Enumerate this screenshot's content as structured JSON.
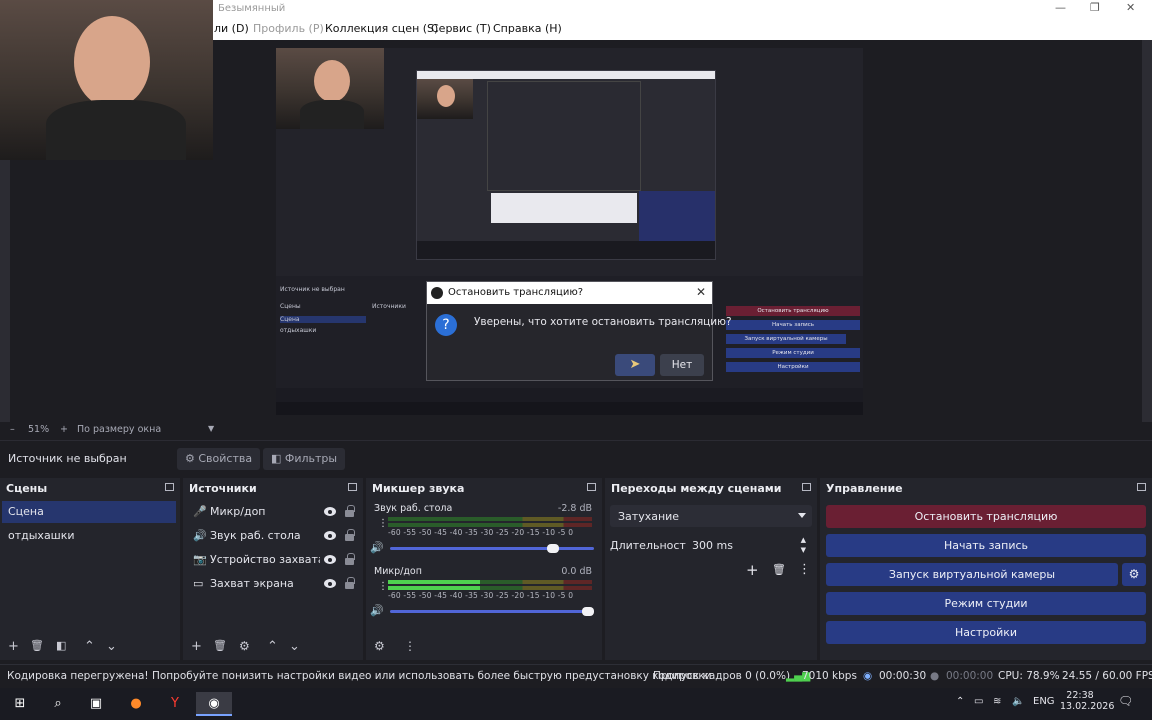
{
  "window": {
    "title": "Безымянный",
    "controls": [
      "—",
      "❐",
      "✕"
    ]
  },
  "menu": {
    "items": [
      "ли (D)",
      "Профиль (P)",
      "Коллекция сцен (S)",
      "Сервис (T)",
      "Справка (H)"
    ]
  },
  "stop_dialog": {
    "title": "Остановить трансляцию?",
    "message": "Уверены, что хотите остановить трансляцию?",
    "yes_label": "Да",
    "no_label": "Нет"
  },
  "zoom": {
    "value": "51%",
    "mode": "По размеру окна"
  },
  "context": {
    "no_source": "Источник не выбран",
    "properties": "Свойства",
    "filters": "Фильтры"
  },
  "scenes": {
    "title": "Сцены",
    "items": [
      "Сцена",
      "отдыхашки"
    ],
    "active_index": 0
  },
  "sources": {
    "title": "Источники",
    "items": [
      {
        "name": "Микр/доп",
        "icon": "microphone-icon"
      },
      {
        "name": "Звук раб. стола",
        "icon": "speaker-icon"
      },
      {
        "name": "Устройство захвата в",
        "icon": "camera-icon"
      },
      {
        "name": "Захват экрана",
        "icon": "monitor-icon"
      }
    ]
  },
  "mixer": {
    "title": "Микшер звука",
    "scale": "-60 -55 -50 -45 -40 -35 -30 -25 -20 -15 -10 -5 0",
    "channels": [
      {
        "name": "Звук раб. стола",
        "db": "-2.8 dB",
        "level": 0.0,
        "volume": 0.83
      },
      {
        "name": "Микр/доп",
        "db": "0.0 dB",
        "level": 0.45,
        "volume": 1.0
      }
    ]
  },
  "transitions": {
    "title": "Переходы между сценами",
    "selected": "Затухание",
    "duration_label": "Длительность",
    "duration_value": "300 ms"
  },
  "controls": {
    "title": "Управление",
    "stop_stream": "Остановить трансляцию",
    "start_recording": "Начать запись",
    "virtual_camera": "Запуск виртуальной камеры",
    "studio_mode": "Режим студии",
    "settings": "Настройки"
  },
  "status": {
    "warning": "Кодировка перегружена! Попробуйте понизить настройки видео или использовать более быструю предустановку кодировки",
    "dropped_frames": "Пропуск кадров 0 (0.0%)",
    "bitrate": "7010 kbps",
    "stream_time": "00:00:30",
    "rec_time": "00:00:00",
    "cpu": "CPU: 78.9%",
    "fps": "24.55 / 60.00 FPS"
  },
  "taskbar": {
    "lang": "ENG",
    "time": "22:38",
    "date": "13.02.2026"
  },
  "colors": {
    "accent_blue": "#283b85",
    "stop_red": "#6a1f33",
    "panel": "#24252c",
    "background": "#1d1d22"
  }
}
